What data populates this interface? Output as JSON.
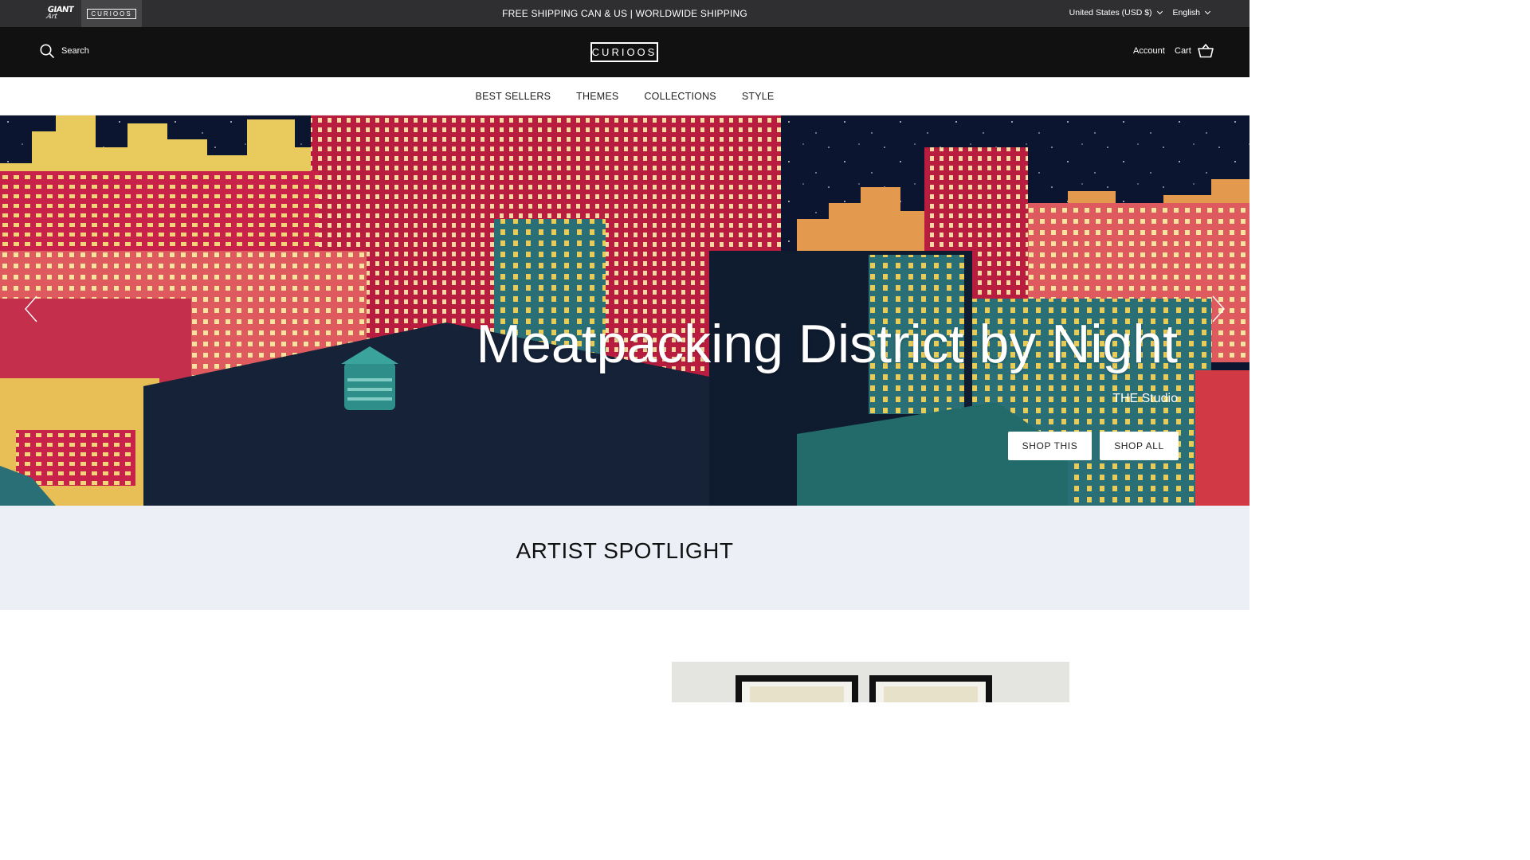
{
  "announcement": {
    "brand_giant": "GIANT",
    "brand_giant_script": "Art",
    "brand_curioos": "CURIOOS",
    "text": "FREE SHIPPING CAN & US | WORLDWIDE SHIPPING",
    "country": "United States (USD $)",
    "language": "English"
  },
  "header": {
    "search_label": "Search",
    "logo": "CURIOOS",
    "account_label": "Account",
    "cart_label": "Cart"
  },
  "nav": {
    "items": [
      "BEST SELLERS",
      "THEMES",
      "COLLECTIONS",
      "STYLE"
    ]
  },
  "hero": {
    "title": "Meatpacking District by Night",
    "subtitle": "THE Studio",
    "button_this": "SHOP THIS",
    "button_all": "SHOP ALL"
  },
  "spotlight": {
    "heading": "ARTIST SPOTLIGHT"
  },
  "colors": {
    "announce_bg": "#2f2f31",
    "header_bg": "#111111",
    "spotlight_bg": "#eceff6",
    "hero_red": "#c8224a",
    "hero_yellow": "#e9cb5d",
    "hero_teal": "#2b7f86",
    "hero_night": "#0c1530"
  },
  "icons": {
    "search": "search-icon",
    "cart": "cart-icon",
    "prev": "chevron-left-icon",
    "next": "chevron-right-icon",
    "dropdown": "chevron-down-icon"
  }
}
